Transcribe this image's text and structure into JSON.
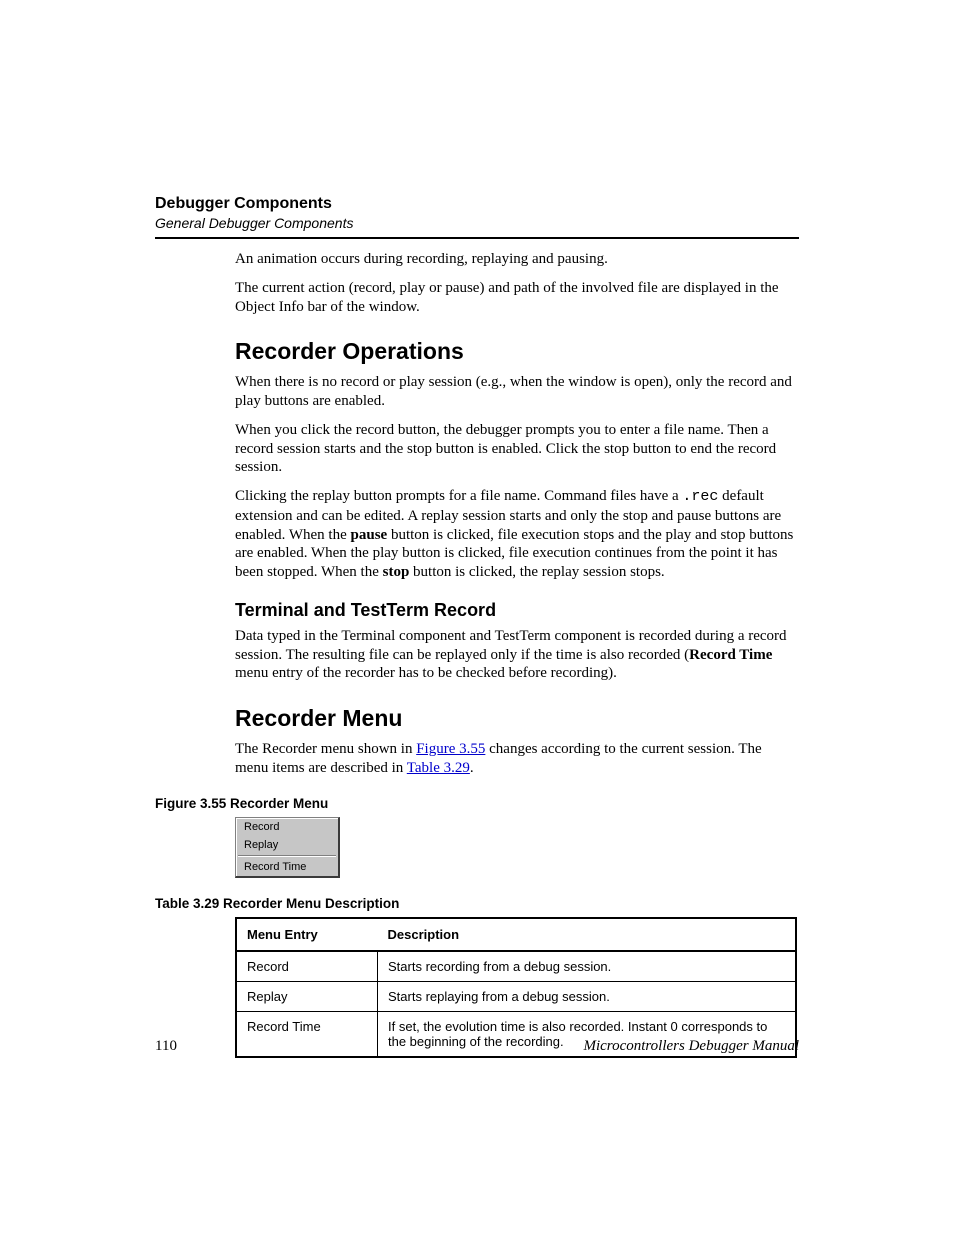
{
  "header": {
    "chapter": "Debugger Components",
    "section": "General Debugger Components"
  },
  "intro": {
    "p1": "An animation occurs during recording, replaying and pausing.",
    "p2": "The current action (record, play or pause) and path of the involved file are displayed in the Object Info bar of the window."
  },
  "recorder_ops": {
    "heading": "Recorder Operations",
    "p1": "When there is no record or play session (e.g., when the window is open), only the record and play buttons are enabled.",
    "p2": "When you click the record button, the debugger prompts you to enter a file name. Then a record session starts and the stop button is enabled. Click the stop button to end the record session.",
    "p3_a": "Clicking the replay button prompts for a file name. Command files have a ",
    "p3_code": ".rec",
    "p3_b": " default extension and can be edited. A replay session starts and only the stop and pause buttons are enabled. When the ",
    "p3_bold1": "pause",
    "p3_c": " button is clicked, file execution stops and the play and stop buttons are enabled. When the play button is clicked, file execution continues from the point it has been stopped. When the ",
    "p3_bold2": "stop",
    "p3_d": " button is clicked, the replay session stops."
  },
  "terminal": {
    "heading": "Terminal and TestTerm Record",
    "p1_a": "Data typed in the Terminal component and TestTerm component is recorded during a record session. The resulting file can be replayed only if the time is also recorded (",
    "p1_bold": "Record Time",
    "p1_b": " menu entry of the recorder has to be checked before recording)."
  },
  "recorder_menu": {
    "heading": "Recorder Menu",
    "p1_a": "The Recorder menu shown in ",
    "p1_link1": "Figure 3.55",
    "p1_b": " changes according to the current session. The menu items are described in ",
    "p1_link2": "Table 3.29",
    "p1_c": "."
  },
  "figure": {
    "caption": "Figure 3.55  Recorder Menu",
    "items": [
      "Record",
      "Replay",
      "Record Time"
    ]
  },
  "table": {
    "caption": "Table 3.29  Recorder Menu Description",
    "headers": [
      "Menu Entry",
      "Description"
    ],
    "rows": [
      {
        "entry": "Record",
        "desc": "Starts recording from a debug session."
      },
      {
        "entry": "Replay",
        "desc": "Starts replaying from a debug session."
      },
      {
        "entry": "Record Time",
        "desc": "If set, the evolution time is also recorded. Instant 0 corresponds to the beginning of the recording."
      }
    ]
  },
  "footer": {
    "page": "110",
    "title": "Microcontrollers Debugger Manual"
  }
}
